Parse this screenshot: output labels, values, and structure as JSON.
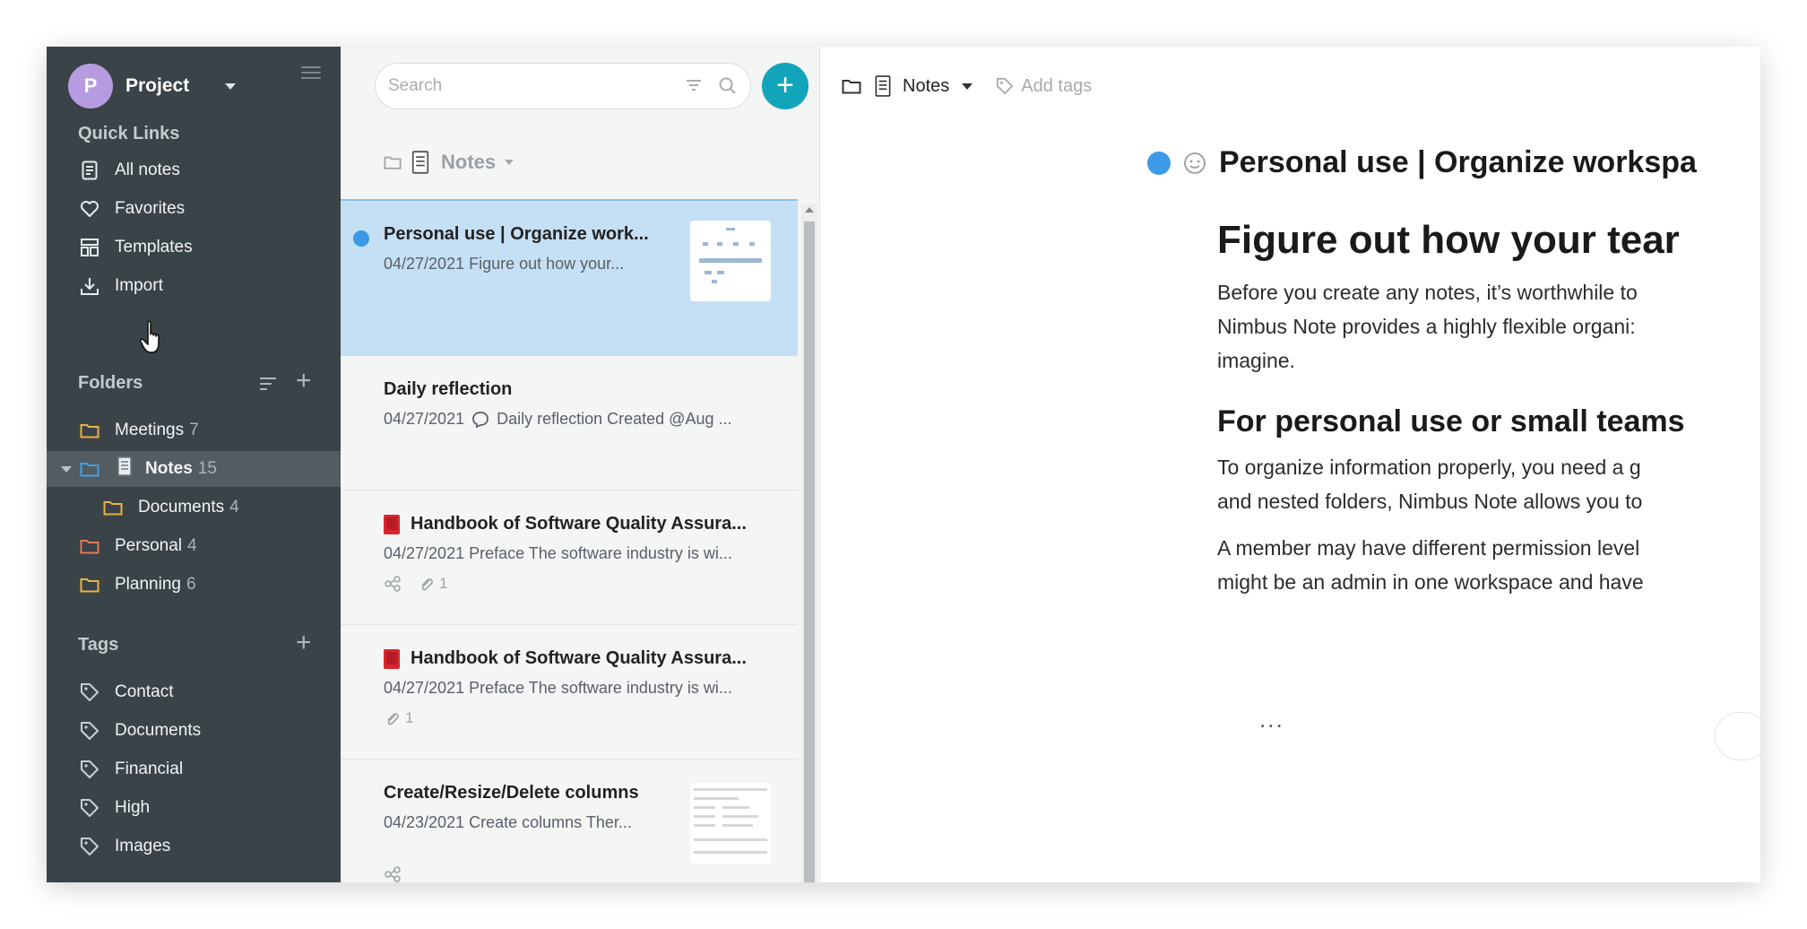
{
  "workspace": {
    "initial": "P",
    "name": "Project"
  },
  "sidebar": {
    "quick_links_title": "Quick Links",
    "quick_links": [
      {
        "label": "All notes",
        "icon": "note-icon"
      },
      {
        "label": "Favorites",
        "icon": "heart-icon"
      },
      {
        "label": "Templates",
        "icon": "template-icon"
      },
      {
        "label": "Import",
        "icon": "download-icon"
      }
    ],
    "folders_title": "Folders",
    "folders": [
      {
        "label": "Meetings",
        "count": "7"
      },
      {
        "label": "Notes",
        "count": "15"
      },
      {
        "label": "Documents",
        "count": "4"
      },
      {
        "label": "Personal",
        "count": "4"
      },
      {
        "label": "Planning",
        "count": "6"
      }
    ],
    "tags_title": "Tags",
    "tags": [
      {
        "label": "Contact"
      },
      {
        "label": "Documents"
      },
      {
        "label": "Financial"
      },
      {
        "label": "High"
      },
      {
        "label": "Images"
      }
    ]
  },
  "notes_list": {
    "search_placeholder": "Search",
    "header": "Notes",
    "items": [
      {
        "title": "Personal use | Organize work...",
        "sub": "04/27/2021 Figure out how your...",
        "meta": ""
      },
      {
        "title": "Daily reflection",
        "sub": "04/27/2021",
        "sub2": "Daily reflection Created @Aug ...",
        "meta": ""
      },
      {
        "title": "Handbook of Software Quality Assura...",
        "sub": "04/27/2021 Preface The software industry is wi...",
        "meta": "1"
      },
      {
        "title": "Handbook of Software Quality Assura...",
        "sub": "04/27/2021 Preface The software industry is wi...",
        "meta": "1"
      },
      {
        "title": "Create/Resize/Delete columns",
        "sub": "04/23/2021 Create columns Ther...",
        "meta": ""
      }
    ]
  },
  "editor": {
    "breadcrumb": "Notes",
    "add_tags": "Add tags",
    "title": "Personal use | Organize workspa",
    "h1": "Figure out how your tear",
    "p1": [
      "Before you create any notes, it’s worthwhile to",
      "Nimbus Note provides a highly flexible organi:",
      "imagine."
    ],
    "h2": "For personal use or small teams",
    "p2": [
      "To organize information properly, you need a g",
      "and nested folders, Nimbus Note allows you to"
    ],
    "p3": [
      "A member may have different permission level",
      "might be an admin in one workspace and have"
    ],
    "ellipsis": "..."
  },
  "colors": {
    "sidebar_bg": "#3a4347",
    "accent": "#12a4bb",
    "selected_note": "#c5dff4",
    "dot_blue": "#3a9ae8"
  }
}
